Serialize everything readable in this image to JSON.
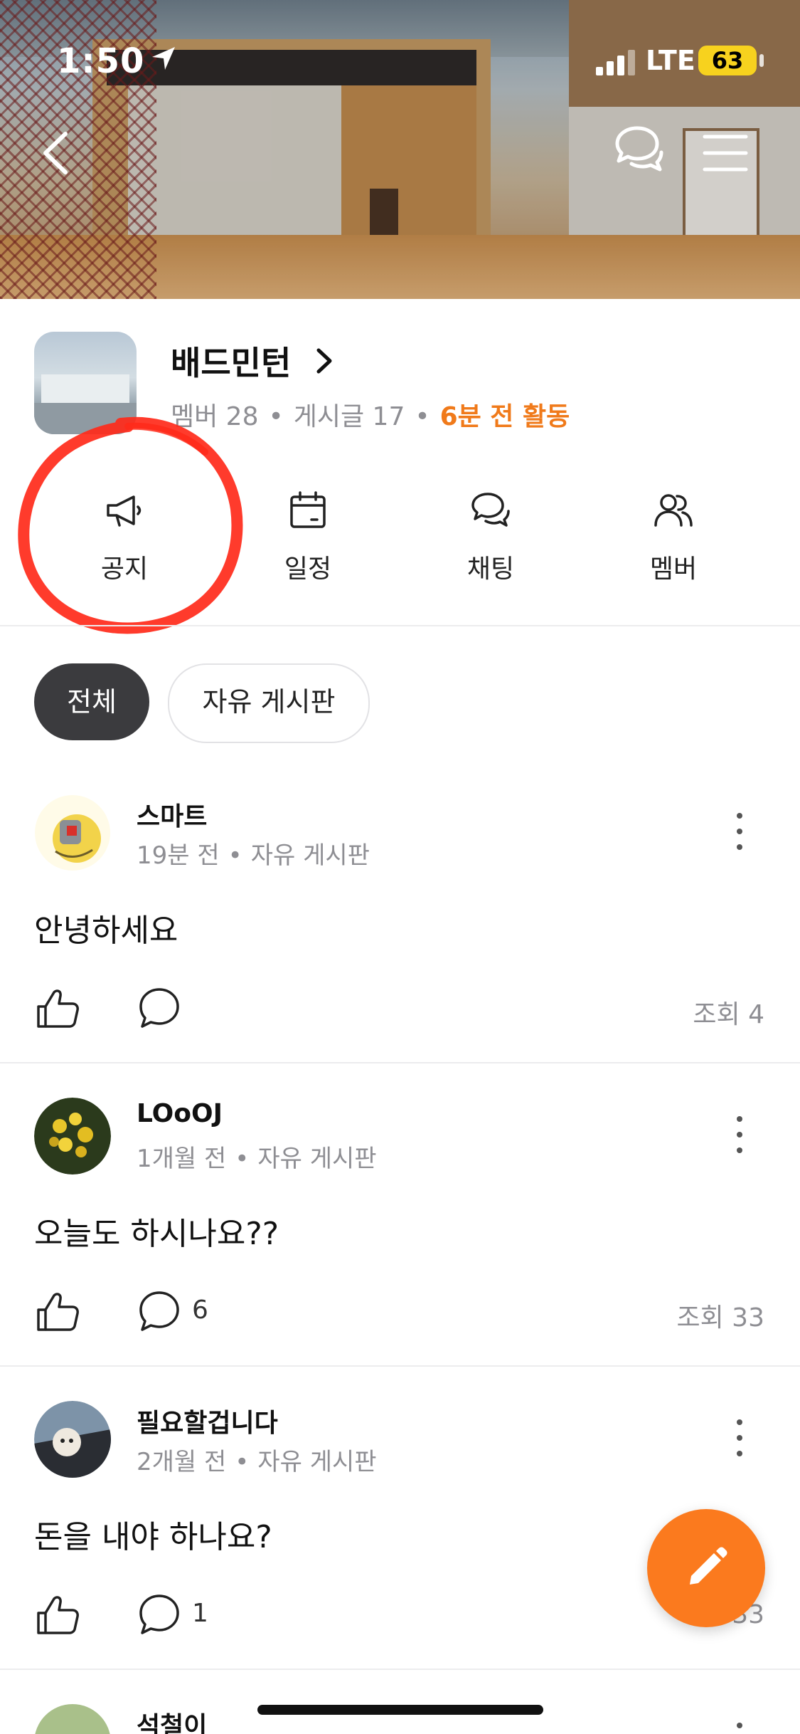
{
  "status_bar": {
    "time": "1:50",
    "network": "LTE",
    "battery": "63"
  },
  "header": {
    "back_icon": "chevron-left-icon",
    "chat_icon": "chat-bubbles-icon",
    "menu_icon": "hamburger-menu-icon"
  },
  "club": {
    "name": "배드민턴",
    "member_label": "멤버 28",
    "post_label": "게시글 17",
    "activity": "6분 전 활동",
    "activity_color": "#f07a1a"
  },
  "quick_menu": [
    {
      "label": "공지",
      "icon": "megaphone-icon"
    },
    {
      "label": "일정",
      "icon": "calendar-icon"
    },
    {
      "label": "채팅",
      "icon": "chat-bubbles-icon"
    },
    {
      "label": "멤버",
      "icon": "members-icon"
    }
  ],
  "tabs": [
    {
      "label": "전체",
      "selected": true
    },
    {
      "label": "자유 게시판",
      "selected": false
    }
  ],
  "posts": [
    {
      "author": "스마트",
      "time": "19분 전",
      "board": "자유 게시판",
      "text": "안녕하세요",
      "comments": "",
      "views": "조회 4"
    },
    {
      "author": "LOoOJ",
      "time": "1개월 전",
      "board": "자유 게시판",
      "text": "오늘도 하시나요??",
      "comments": "6",
      "views": "조회 33"
    },
    {
      "author": "필요할겁니다",
      "time": "2개월 전",
      "board": "자유 게시판",
      "text": "돈을 내야 하나요?",
      "comments": "1",
      "views": "33"
    },
    {
      "author": "석철이"
    }
  ],
  "fab": {
    "icon": "pencil-icon",
    "color": "#fb7a1e"
  }
}
